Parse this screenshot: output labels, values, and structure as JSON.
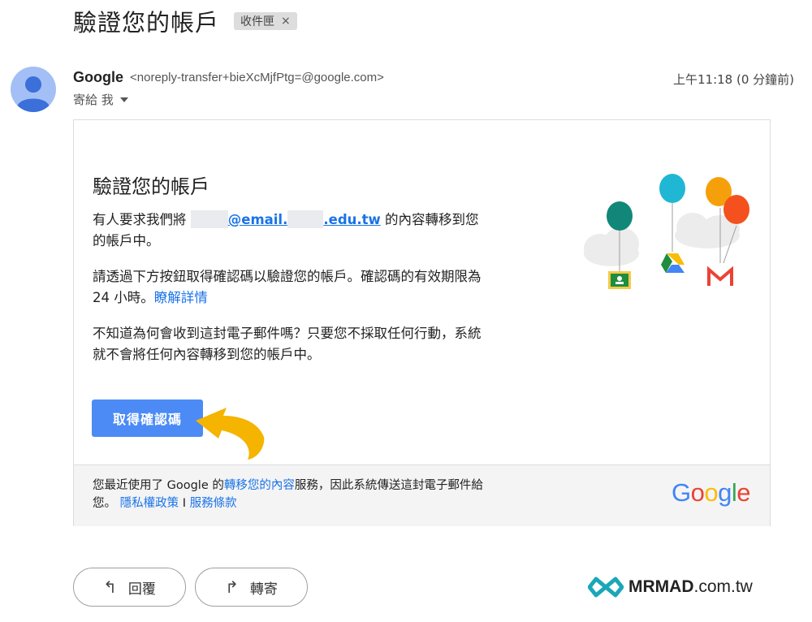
{
  "subject": {
    "title": "驗證您的帳戶",
    "label": "收件匣",
    "label_close": "×"
  },
  "sender": {
    "name": "Google",
    "email": "<noreply-transfer+bieXcMjfPtg=@google.com>",
    "recipient": "寄給 我",
    "time": "上午11:18 (0 分鐘前)"
  },
  "card": {
    "title": "驗證您的帳戶",
    "p1": {
      "prefix": "有人要求我們將",
      "email_part1": "@email.",
      "email_part2": ".edu.tw",
      "suffix": "的內容轉移到您的帳戶中。"
    },
    "p2": {
      "text": "請透過下方按鈕取得確認碼以驗證您的帳戶。確認碼的有效期限為 24 小時。",
      "link": "瞭解詳情"
    },
    "p3": "不知道為何會收到這封電子郵件嗎？只要您不採取任何行動，系統就不會將任何內容轉移到您的帳戶中。",
    "button": "取得確認碼",
    "footer": {
      "prefix": "您最近使用了 Google 的",
      "link1": "轉移您的內容",
      "middle": "服務，因此系統傳送這封電子郵件給您。",
      "link2": "隱私權政策",
      "sep": "I",
      "link3": "服務條款"
    },
    "logo": {
      "g1": "G",
      "o1": "o",
      "o2": "o",
      "g2": "g",
      "l": "l",
      "e": "e"
    }
  },
  "actions": {
    "reply": "回覆",
    "reply_icon": "↰",
    "forward": "轉寄",
    "forward_icon": "↱"
  },
  "watermark": {
    "brand": "MRMAD",
    "domain": ".com.tw"
  },
  "colors": {
    "accent": "#4c8bf5",
    "link": "#1a73e8",
    "arrow": "#f5b400"
  }
}
